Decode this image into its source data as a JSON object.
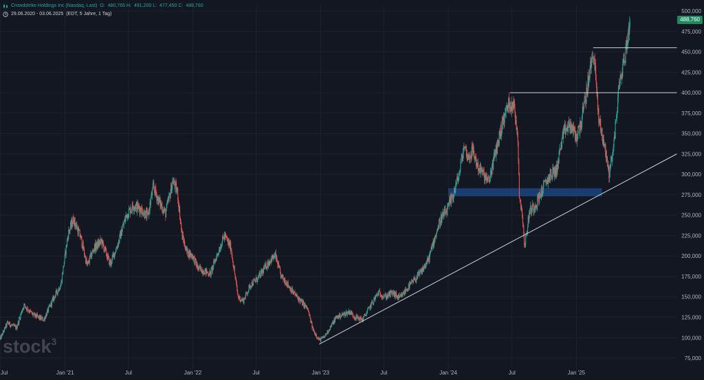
{
  "legend": {
    "symbol_name": "Crowdstrike Holdings Inc (Nasdaq, Last)",
    "open_label": "O:",
    "open_value": "480,765",
    "high_label": "H:",
    "high_value": "491,200",
    "low_label": "L:",
    "low_value": "477,450",
    "close_label": "C:",
    "close_value": "488,760",
    "range_text": "29.06.2020 - 03.06.2025",
    "settings_text": "(EDT, 5 Jahre, 1 Tag)"
  },
  "watermark": {
    "text": "stock",
    "superscript": "3"
  },
  "colors": {
    "background": "#131722",
    "grid": "#1e222d",
    "up": "#26a69a",
    "down": "#ef5350",
    "axis_text": "#b2b5be",
    "trendline": "#d1d4dc",
    "zone": "#1e4a8c",
    "price_tag": "#1e8a60"
  },
  "chart_data": {
    "type": "candlestick",
    "title": "Crowdstrike Holdings Inc (Nasdaq, Last)",
    "x_range": [
      "2020-06-29",
      "2025-06-03"
    ],
    "ylim": [
      70000,
      500000
    ],
    "y_ticks": [
      75000,
      100000,
      125000,
      150000,
      175000,
      200000,
      225000,
      250000,
      275000,
      300000,
      325000,
      350000,
      375000,
      400000,
      425000,
      450000,
      475000,
      500000
    ],
    "y_tick_labels": [
      "75,000",
      "100,000",
      "125,000",
      "150,000",
      "175,000",
      "200,000",
      "225,000",
      "250,000",
      "275,000",
      "300,000",
      "325,000",
      "350,000",
      "375,000",
      "400,000",
      "425,000",
      "450,000",
      "475,000",
      "500,000"
    ],
    "x_ticks": [
      {
        "label": "Jul",
        "date": "2020-07-01"
      },
      {
        "label": "Jan '21",
        "date": "2021-01-01"
      },
      {
        "label": "Jul",
        "date": "2021-07-01"
      },
      {
        "label": "Jan '22",
        "date": "2022-01-01"
      },
      {
        "label": "Jul",
        "date": "2022-07-01"
      },
      {
        "label": "Jan '23",
        "date": "2023-01-01"
      },
      {
        "label": "Jul",
        "date": "2023-07-01"
      },
      {
        "label": "Jan '24",
        "date": "2024-01-01"
      },
      {
        "label": "Jul",
        "date": "2024-07-01"
      },
      {
        "label": "Jan '25",
        "date": "2025-01-01"
      }
    ],
    "price_path": [
      [
        "2020-06-29",
        98000
      ],
      [
        "2020-07-20",
        118000
      ],
      [
        "2020-08-15",
        112000
      ],
      [
        "2020-09-05",
        140000
      ],
      [
        "2020-10-01",
        128000
      ],
      [
        "2020-11-01",
        122000
      ],
      [
        "2020-12-01",
        150000
      ],
      [
        "2020-12-20",
        165000
      ],
      [
        "2021-01-10",
        228000
      ],
      [
        "2021-01-25",
        245000
      ],
      [
        "2021-02-15",
        222000
      ],
      [
        "2021-03-05",
        188000
      ],
      [
        "2021-03-25",
        210000
      ],
      [
        "2021-04-15",
        218000
      ],
      [
        "2021-05-10",
        190000
      ],
      [
        "2021-06-01",
        215000
      ],
      [
        "2021-06-25",
        250000
      ],
      [
        "2021-07-15",
        262000
      ],
      [
        "2021-08-05",
        258000
      ],
      [
        "2021-08-25",
        248000
      ],
      [
        "2021-09-10",
        285000
      ],
      [
        "2021-09-25",
        268000
      ],
      [
        "2021-10-15",
        252000
      ],
      [
        "2021-11-05",
        292000
      ],
      [
        "2021-11-18",
        278000
      ],
      [
        "2021-12-01",
        225000
      ],
      [
        "2021-12-15",
        205000
      ],
      [
        "2022-01-01",
        200000
      ],
      [
        "2022-01-15",
        185000
      ],
      [
        "2022-02-01",
        182000
      ],
      [
        "2022-02-20",
        178000
      ],
      [
        "2022-03-10",
        200000
      ],
      [
        "2022-04-01",
        225000
      ],
      [
        "2022-04-20",
        210000
      ],
      [
        "2022-05-10",
        150000
      ],
      [
        "2022-05-25",
        145000
      ],
      [
        "2022-06-15",
        165000
      ],
      [
        "2022-07-05",
        172000
      ],
      [
        "2022-07-25",
        185000
      ],
      [
        "2022-08-10",
        195000
      ],
      [
        "2022-08-25",
        200000
      ],
      [
        "2022-09-10",
        175000
      ],
      [
        "2022-09-25",
        168000
      ],
      [
        "2022-10-15",
        155000
      ],
      [
        "2022-11-05",
        145000
      ],
      [
        "2022-11-25",
        135000
      ],
      [
        "2022-12-10",
        110000
      ],
      [
        "2022-12-28",
        97000
      ],
      [
        "2023-01-10",
        100000
      ],
      [
        "2023-01-25",
        110000
      ],
      [
        "2023-02-15",
        125000
      ],
      [
        "2023-03-05",
        128000
      ],
      [
        "2023-03-25",
        132000
      ],
      [
        "2023-04-10",
        125000
      ],
      [
        "2023-05-01",
        122000
      ],
      [
        "2023-05-25",
        140000
      ],
      [
        "2023-06-15",
        155000
      ],
      [
        "2023-07-05",
        150000
      ],
      [
        "2023-07-25",
        155000
      ],
      [
        "2023-08-15",
        148000
      ],
      [
        "2023-09-05",
        160000
      ],
      [
        "2023-09-25",
        170000
      ],
      [
        "2023-10-15",
        180000
      ],
      [
        "2023-11-05",
        195000
      ],
      [
        "2023-11-25",
        225000
      ],
      [
        "2023-12-10",
        245000
      ],
      [
        "2023-12-28",
        255000
      ],
      [
        "2024-01-15",
        275000
      ],
      [
        "2024-02-01",
        300000
      ],
      [
        "2024-02-15",
        335000
      ],
      [
        "2024-02-28",
        320000
      ],
      [
        "2024-03-10",
        330000
      ],
      [
        "2024-03-25",
        310000
      ],
      [
        "2024-04-10",
        300000
      ],
      [
        "2024-04-25",
        290000
      ],
      [
        "2024-05-10",
        318000
      ],
      [
        "2024-05-25",
        345000
      ],
      [
        "2024-06-05",
        365000
      ],
      [
        "2024-06-20",
        385000
      ],
      [
        "2024-07-05",
        388000
      ],
      [
        "2024-07-18",
        345000
      ],
      [
        "2024-07-22",
        275000
      ],
      [
        "2024-08-01",
        245000
      ],
      [
        "2024-08-06",
        210000
      ],
      [
        "2024-08-20",
        255000
      ],
      [
        "2024-09-05",
        262000
      ],
      [
        "2024-09-20",
        275000
      ],
      [
        "2024-10-05",
        290000
      ],
      [
        "2024-10-20",
        300000
      ],
      [
        "2024-11-05",
        305000
      ],
      [
        "2024-11-20",
        340000
      ],
      [
        "2024-12-01",
        355000
      ],
      [
        "2024-12-15",
        360000
      ],
      [
        "2025-01-01",
        345000
      ],
      [
        "2025-01-15",
        365000
      ],
      [
        "2025-01-28",
        395000
      ],
      [
        "2025-02-10",
        430000
      ],
      [
        "2025-02-20",
        450000
      ],
      [
        "2025-03-05",
        370000
      ],
      [
        "2025-03-20",
        340000
      ],
      [
        "2025-04-05",
        300000
      ],
      [
        "2025-04-20",
        345000
      ],
      [
        "2025-05-01",
        400000
      ],
      [
        "2025-05-10",
        425000
      ],
      [
        "2025-05-20",
        445000
      ],
      [
        "2025-05-28",
        470000
      ],
      [
        "2025-06-03",
        488760
      ]
    ],
    "annotations": {
      "trendline": {
        "from": [
          "2022-12-28",
          92000
        ],
        "to": [
          "2025-10-15",
          325000
        ]
      },
      "resistance_lines": [
        {
          "from": "2024-06-25",
          "to": "2025-10-15",
          "value": 400000
        },
        {
          "from": "2025-02-18",
          "to": "2025-10-15",
          "value": 455000
        }
      ],
      "support_zone": {
        "from": "2024-01-01",
        "to": "2025-03-15",
        "top": 283000,
        "bottom": 273000
      }
    },
    "last_price": 488760,
    "last_price_label": "488,760"
  }
}
